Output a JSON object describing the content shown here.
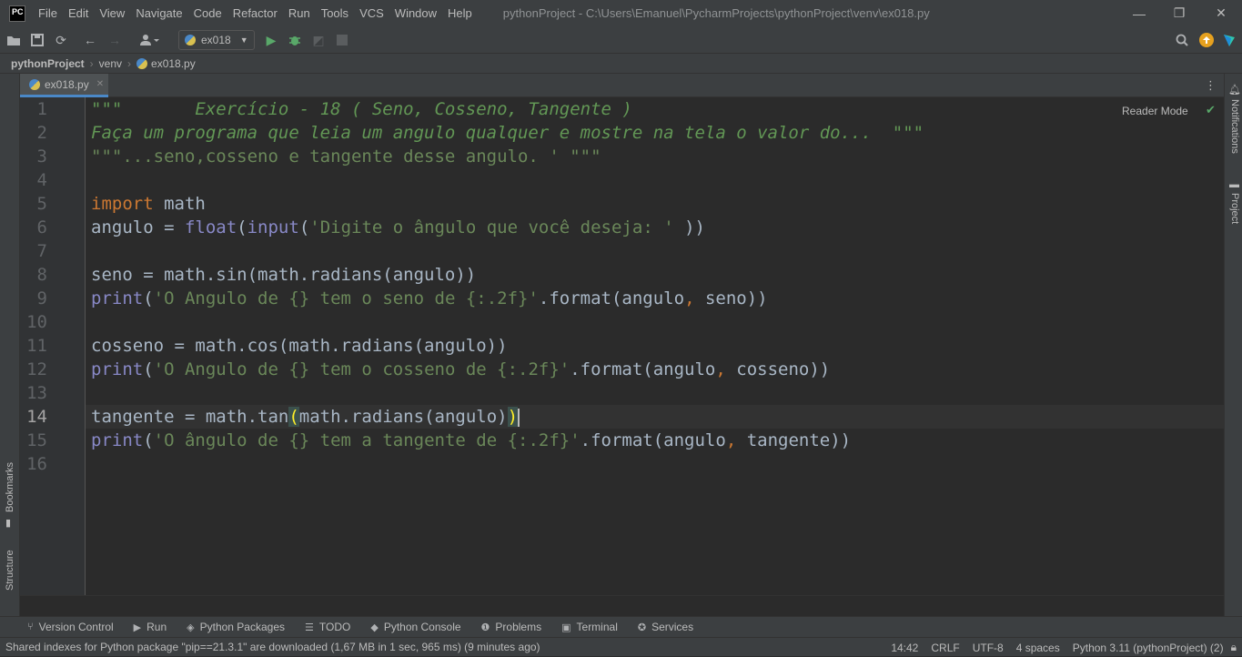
{
  "titlebar": {
    "logo": "PC",
    "menu": [
      "File",
      "Edit",
      "View",
      "Navigate",
      "Code",
      "Refactor",
      "Run",
      "Tools",
      "VCS",
      "Window",
      "Help"
    ],
    "title": "pythonProject - C:\\Users\\Emanuel\\PycharmProjects\\pythonProject\\venv\\ex018.py",
    "minimize": "—",
    "maximize": "❐",
    "close": "✕"
  },
  "toolbar": {
    "run_config": "ex018",
    "icons": [
      "open-folder-icon",
      "save-icon",
      "sync-icon",
      "back-icon",
      "forward-icon",
      "user-icon",
      "run-icon",
      "debug-icon",
      "coverage-icon",
      "stop-icon",
      "search-icon",
      "update-icon",
      "jetbrains-icon"
    ]
  },
  "navbar": {
    "crumbs": [
      "pythonProject",
      "venv",
      "ex018.py"
    ]
  },
  "tabs": [
    {
      "label": "ex018.py",
      "close": "✕"
    }
  ],
  "editor": {
    "reader_mode": "Reader Mode",
    "line_numbers": [
      "1",
      "2",
      "3",
      "4",
      "5",
      "6",
      "7",
      "8",
      "9",
      "10",
      "11",
      "12",
      "13",
      "14",
      "15",
      "16"
    ],
    "current_line": "14"
  },
  "left_stripe": {
    "bookmarks": "Bookmarks",
    "structure": "Structure"
  },
  "right_stripe": {
    "notifications": "Notifications",
    "project": "Project"
  },
  "toolwindows": [
    {
      "label": "Version Control",
      "icon": "branch-icon"
    },
    {
      "label": "Run",
      "icon": "run-icon"
    },
    {
      "label": "Python Packages",
      "icon": "packages-icon"
    },
    {
      "label": "TODO",
      "icon": "list-icon"
    },
    {
      "label": "Python Console",
      "icon": "console-icon"
    },
    {
      "label": "Problems",
      "icon": "problems-icon"
    },
    {
      "label": "Terminal",
      "icon": "terminal-icon"
    },
    {
      "label": "Services",
      "icon": "services-icon"
    }
  ],
  "statusbar": {
    "message": "Shared indexes for Python package \"pip==21.3.1\" are downloaded (1,67 MB in 1 sec, 965 ms) (9 minutes ago)",
    "position": "14:42",
    "line_sep": "CRLF",
    "encoding": "UTF-8",
    "indent": "4 spaces",
    "interpreter": "Python 3.11 (pythonProject) (2)"
  },
  "colors": {
    "background": "#2b2b2b",
    "panel": "#3c3f41",
    "keyword": "#cc7832",
    "string": "#6a8759",
    "docstring": "#629755",
    "builtin": "#8888c6",
    "text": "#a9b7c6"
  }
}
